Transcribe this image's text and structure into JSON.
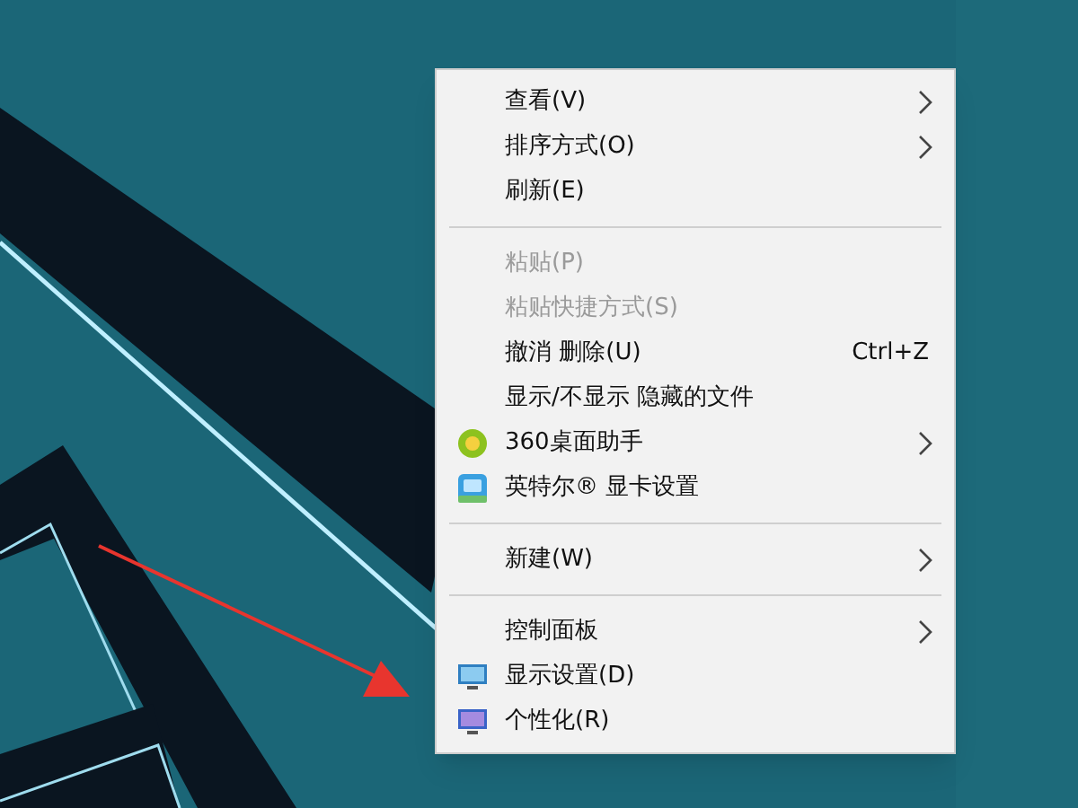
{
  "context_menu": {
    "items": [
      {
        "kind": "item",
        "label": "查看(V)",
        "submenu": true,
        "disabled": false
      },
      {
        "kind": "item",
        "label": "排序方式(O)",
        "submenu": true,
        "disabled": false
      },
      {
        "kind": "item",
        "label": "刷新(E)",
        "submenu": false,
        "disabled": false
      },
      {
        "kind": "separator"
      },
      {
        "kind": "item",
        "label": "粘贴(P)",
        "submenu": false,
        "disabled": true
      },
      {
        "kind": "item",
        "label": "粘贴快捷方式(S)",
        "submenu": false,
        "disabled": true
      },
      {
        "kind": "item",
        "label": "撤消 删除(U)",
        "shortcut": "Ctrl+Z",
        "submenu": false,
        "disabled": false
      },
      {
        "kind": "item",
        "label": "显示/不显示 隐藏的文件",
        "submenu": false,
        "disabled": false
      },
      {
        "kind": "item",
        "label": "360桌面助手",
        "submenu": true,
        "disabled": false
      },
      {
        "kind": "item",
        "label": "英特尔® 显卡设置",
        "submenu": false,
        "disabled": false
      },
      {
        "kind": "separator"
      },
      {
        "kind": "item",
        "label": "新建(W)",
        "submenu": true,
        "disabled": false
      },
      {
        "kind": "separator"
      },
      {
        "kind": "item",
        "label": "控制面板",
        "submenu": true,
        "disabled": false
      },
      {
        "kind": "item",
        "label": "显示设置(D)",
        "submenu": false,
        "disabled": false
      },
      {
        "kind": "item",
        "label": "个性化(R)",
        "submenu": false,
        "disabled": false
      }
    ]
  }
}
